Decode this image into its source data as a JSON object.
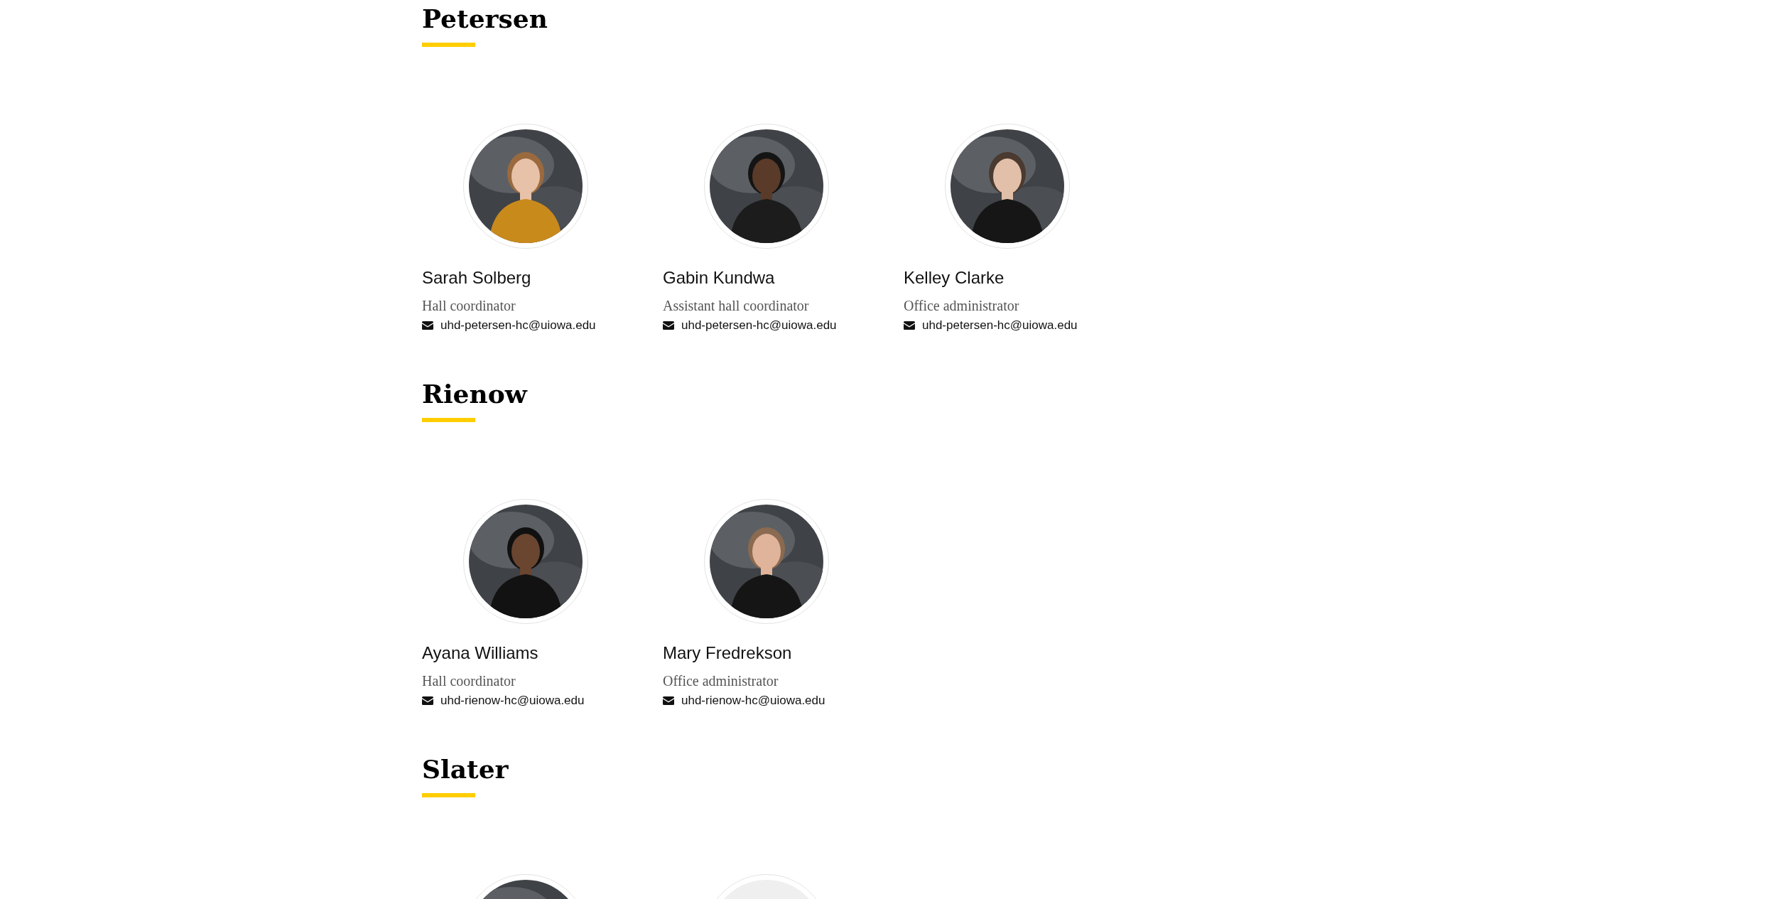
{
  "sections": [
    {
      "heading": "Petersen",
      "people": [
        {
          "name": "Sarah Solberg",
          "title": "Hall coordinator",
          "email": "uhd-petersen-hc@uiowa.edu",
          "photo": {
            "kind": "picture"
          }
        },
        {
          "name": "Gabin Kundwa",
          "title": "Assistant hall coordinator",
          "email": "uhd-petersen-hc@uiowa.edu",
          "photo": {
            "kind": "picture"
          }
        },
        {
          "name": "Kelley Clarke",
          "title": "Office administrator",
          "email": "uhd-petersen-hc@uiowa.edu",
          "photo": {
            "kind": "picture"
          }
        }
      ]
    },
    {
      "heading": "Rienow",
      "people": [
        {
          "name": "Ayana Williams",
          "title": "Hall coordinator",
          "email": "uhd-rienow-hc@uiowa.edu",
          "photo": {
            "kind": "picture"
          }
        },
        {
          "name": "Mary Fredrekson",
          "title": "Office administrator",
          "email": "uhd-rienow-hc@uiowa.edu",
          "photo": {
            "kind": "picture"
          }
        }
      ]
    },
    {
      "heading": "Slater",
      "people": [
        {
          "photo": {
            "kind": "picture"
          }
        },
        {
          "photo": {
            "kind": "placeholder"
          }
        }
      ]
    }
  ]
}
